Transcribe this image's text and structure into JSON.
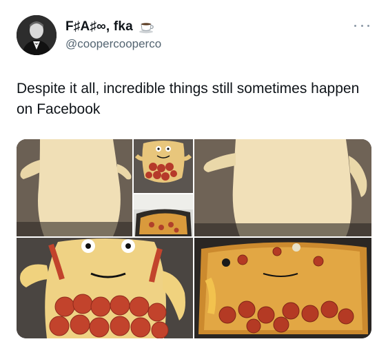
{
  "author": {
    "display_name": "F♯A♯∞, fka",
    "badge_icon": "coffee-cup-icon",
    "handle": "@coopercooperco",
    "avatar_icon": "profile-photo"
  },
  "menu": {
    "icon": "more-options-icon"
  },
  "tweet": {
    "text": "Despite it all, incredible things still sometimes happen on Facebook"
  },
  "media": [
    {
      "icon": "dough-figure-photo"
    },
    {
      "icon": "topped-pizza-figure-photo"
    },
    {
      "icon": "baked-pizza-small-photo"
    },
    {
      "icon": "dough-figure-closeup-photo"
    },
    {
      "icon": "pizza-face-with-pepperoni-photo"
    },
    {
      "icon": "baked-pizza-face-photo"
    }
  ],
  "colors": {
    "text_primary": "#0f1419",
    "text_secondary": "#536471",
    "background": "#ffffff"
  }
}
